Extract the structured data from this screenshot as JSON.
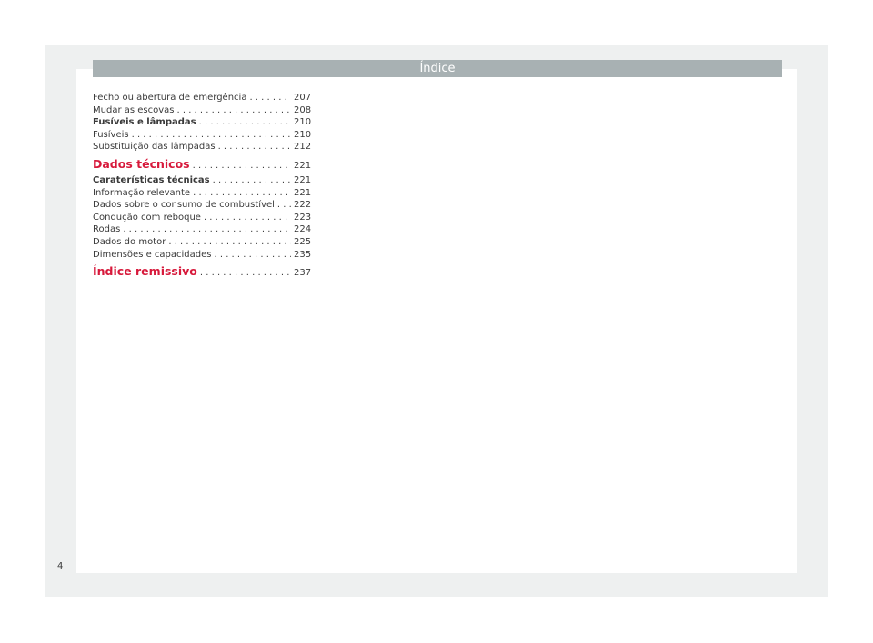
{
  "header": {
    "title": "Índice"
  },
  "toc": [
    {
      "label": "Fecho ou abertura de emergência",
      "page": "207",
      "style": "normal"
    },
    {
      "label": "Mudar as escovas",
      "page": "208",
      "style": "normal"
    },
    {
      "label": "Fusíveis e lâmpadas",
      "page": "210",
      "style": "bold"
    },
    {
      "label": "Fusíveis",
      "page": "210",
      "style": "normal"
    },
    {
      "label": "Substituição das lâmpadas",
      "page": "212",
      "style": "normal"
    },
    {
      "label": "Dados técnicos",
      "page": "221",
      "style": "section"
    },
    {
      "label": "Caraterísticas técnicas",
      "page": "221",
      "style": "bold"
    },
    {
      "label": "Informação relevante",
      "page": "221",
      "style": "normal"
    },
    {
      "label": "Dados sobre o consumo de combustível",
      "page": "222",
      "style": "normal"
    },
    {
      "label": "Condução com reboque",
      "page": "223",
      "style": "normal"
    },
    {
      "label": "Rodas",
      "page": "224",
      "style": "normal"
    },
    {
      "label": "Dados do motor",
      "page": "225",
      "style": "normal"
    },
    {
      "label": "Dimensões e capacidades",
      "page": "235",
      "style": "normal"
    },
    {
      "label": "Índice remissivo",
      "page": "237",
      "style": "section"
    }
  ],
  "footer": {
    "page_number": "4"
  },
  "colors": {
    "section_accent": "#d7193b",
    "header_bar": "#a8b1b3"
  }
}
